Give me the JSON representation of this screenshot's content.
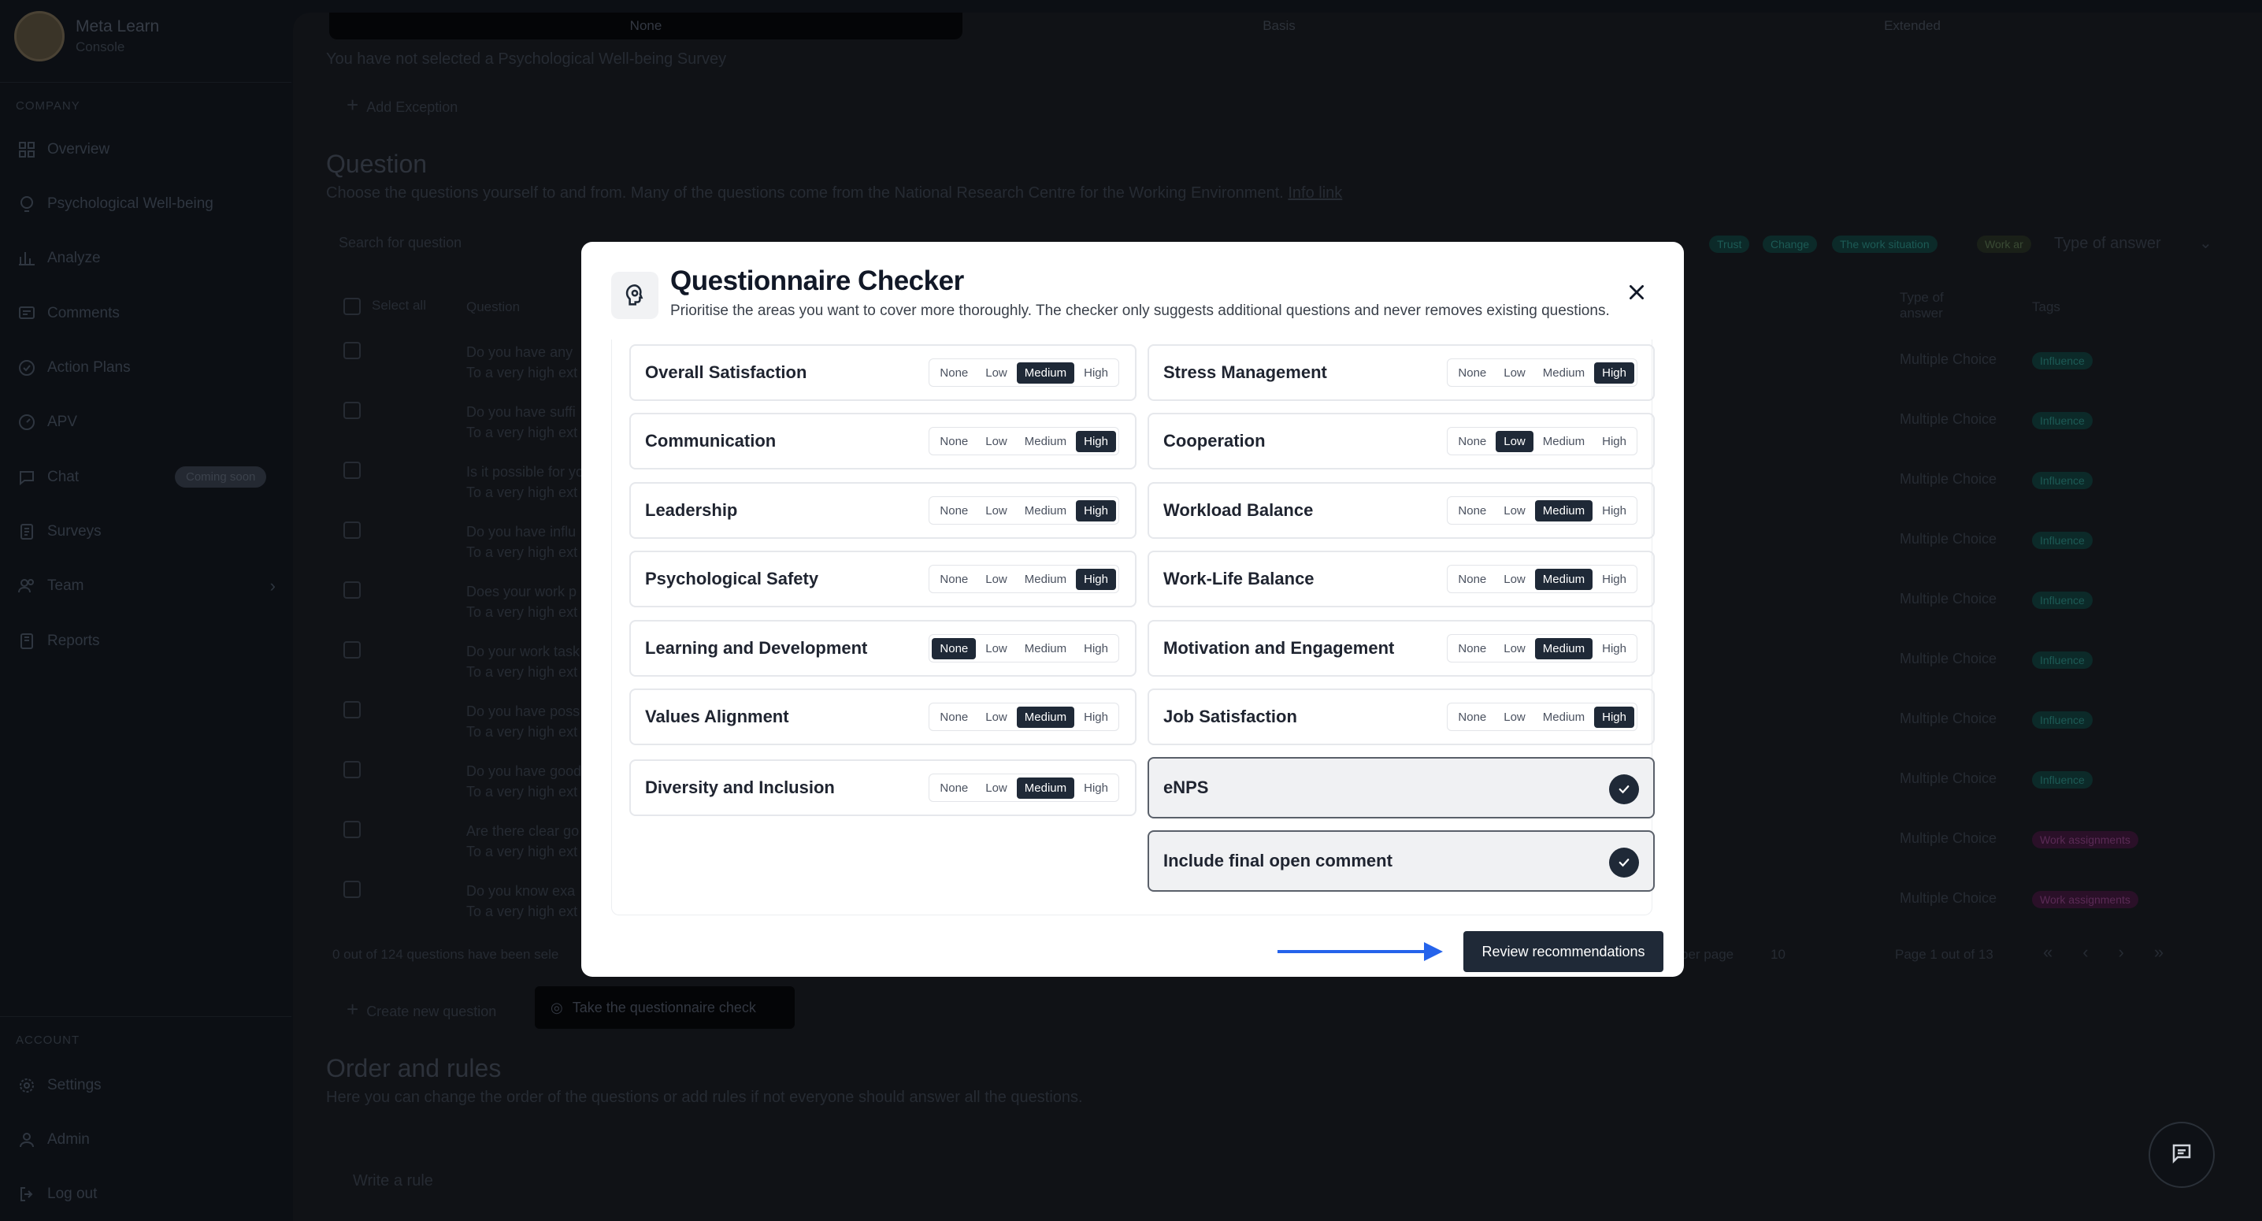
{
  "sidebar": {
    "brand_name": "Meta Learn",
    "brand_sub": "Console",
    "company_heading": "COMPANY",
    "items": [
      {
        "label": "Overview",
        "icon": "grid-icon"
      },
      {
        "label": "Psychological Well-being",
        "icon": "head-icon"
      },
      {
        "label": "Analyze",
        "icon": "bar-chart-icon"
      },
      {
        "label": "Comments",
        "icon": "comment-icon"
      },
      {
        "label": "Action Plans",
        "icon": "check-circle-icon"
      },
      {
        "label": "APV",
        "icon": "gauge-icon"
      },
      {
        "label": "Chat",
        "icon": "chat-icon",
        "badge": "Coming soon"
      },
      {
        "label": "Surveys",
        "icon": "document-icon"
      },
      {
        "label": "Team",
        "icon": "team-icon"
      },
      {
        "label": "Reports",
        "icon": "report-icon"
      }
    ],
    "account_heading": "ACCOUNT",
    "account_items": [
      {
        "label": "Settings",
        "icon": "gear-icon"
      },
      {
        "label": "Admin",
        "icon": "admin-icon"
      },
      {
        "label": "Log out",
        "icon": "logout-icon"
      }
    ]
  },
  "background": {
    "tabs": [
      "None",
      "Basis",
      "Extended"
    ],
    "survey_note": "You have not selected a Psychological Well-being Survey",
    "add_exception": "Add Exception",
    "question_title": "Question",
    "question_desc": "Choose the questions yourself to and from. Many of the questions come from the National Research Centre for the Working Environment.",
    "info_link": "Info link",
    "search_placeholder": "Search for question",
    "filter_tags": [
      "Trust",
      "Change",
      "The work situation",
      "Work ar"
    ],
    "type_of_answer_filter": "Type of answer",
    "select_all": "Select all",
    "col_question": "Question",
    "col_type": "Type of answer",
    "col_tags": "Tags",
    "rows": [
      {
        "q": "Do you have any",
        "sub": "To a very high ext",
        "type": "Multiple Choice",
        "tag": "Influence"
      },
      {
        "q": "Do you have suffi",
        "sub": "To a very high ext",
        "type": "Multiple Choice",
        "tag": "Influence"
      },
      {
        "q": "Is it possible for yo",
        "sub": "To a very high ext",
        "type": "Multiple Choice",
        "tag": "Influence"
      },
      {
        "q": "Do you have influ",
        "sub": "To a very high ext",
        "type": "Multiple Choice",
        "tag": "Influence"
      },
      {
        "q": "Does your work p",
        "sub": "To a very high ext",
        "type": "Multiple Choice",
        "tag": "Influence"
      },
      {
        "q": "Do your work task",
        "sub": "To a very high ext",
        "type": "Multiple Choice",
        "tag": "Influence"
      },
      {
        "q": "Do you have poss",
        "sub": "To a very high ext",
        "type": "Multiple Choice",
        "tag": "Influence"
      },
      {
        "q": "Do you have good",
        "sub": "To a very high ext",
        "type": "Multiple Choice",
        "tag": "Influence"
      },
      {
        "q": "Are there clear go",
        "sub": "To a very high ext",
        "type": "Multiple Choice",
        "tag": "Work assignments"
      },
      {
        "q": "Do you know exa",
        "sub": "To a very high ext",
        "type": "Multiple Choice",
        "tag": "Work assignments"
      }
    ],
    "selected_count": "0 out of 124 questions have been sele",
    "per_page_label": "per page",
    "per_page_value": "10",
    "page_info": "Page 1 out of 13",
    "create_question": "Create new question",
    "take_check": "Take the questionnaire check",
    "order_title": "Order and rules",
    "order_desc": "Here you can change the order of the questions or add rules if not everyone should answer all the questions.",
    "rule_placeholder": "Write a rule"
  },
  "modal": {
    "title": "Questionnaire Checker",
    "subtitle": "Prioritise the areas you want to cover more thoroughly. The checker only suggests additional questions and never removes existing questions.",
    "levels": [
      "None",
      "Low",
      "Medium",
      "High"
    ],
    "areas_left": [
      {
        "label": "Overall Satisfaction",
        "value": "Medium"
      },
      {
        "label": "Communication",
        "value": "High"
      },
      {
        "label": "Leadership",
        "value": "High"
      },
      {
        "label": "Psychological Safety",
        "value": "High"
      },
      {
        "label": "Learning and Development",
        "value": "None"
      },
      {
        "label": "Values Alignment",
        "value": "Medium"
      },
      {
        "label": "Diversity and Inclusion",
        "value": "Medium"
      }
    ],
    "areas_right": [
      {
        "label": "Stress Management",
        "value": "High"
      },
      {
        "label": "Cooperation",
        "value": "Low"
      },
      {
        "label": "Workload Balance",
        "value": "Medium"
      },
      {
        "label": "Work-Life Balance",
        "value": "Medium"
      },
      {
        "label": "Motivation and Engagement",
        "value": "Medium"
      },
      {
        "label": "Job Satisfaction",
        "value": "High"
      }
    ],
    "toggles": [
      {
        "label": "eNPS",
        "checked": true
      },
      {
        "label": "Include final open comment",
        "checked": true
      }
    ],
    "review_button": "Review recommendations",
    "accent_color": "#1f2937",
    "arrow_color": "#2563eb"
  }
}
